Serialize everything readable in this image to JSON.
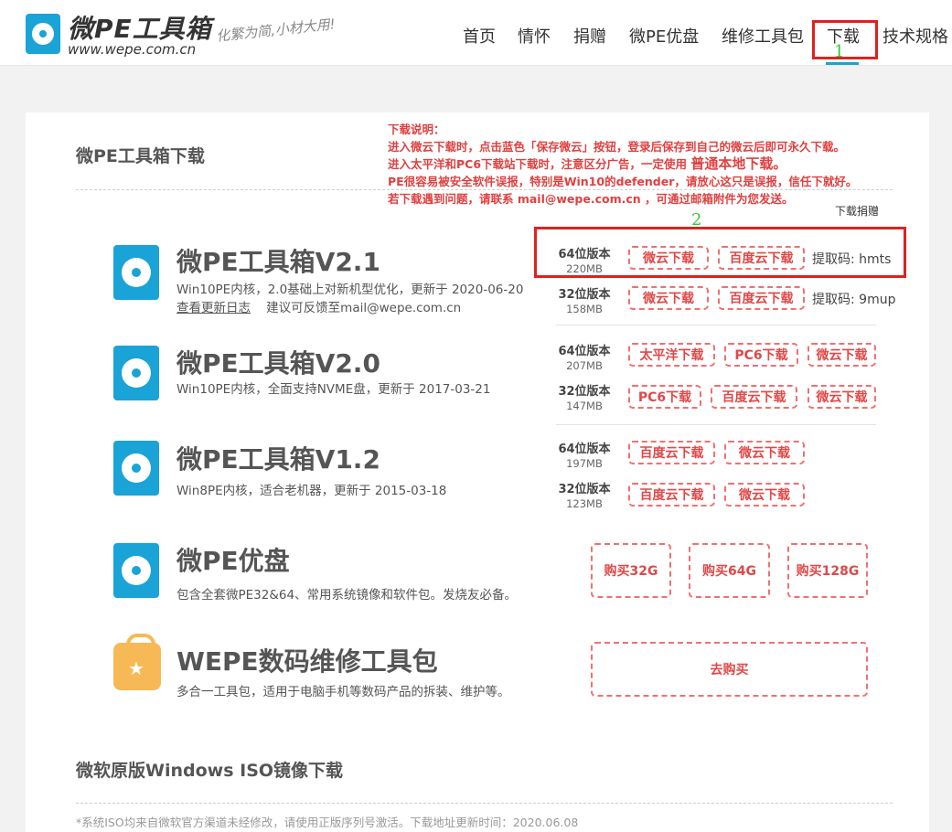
{
  "header": {
    "logo_title": "微PE工具箱",
    "logo_url": "www.wepe.com.cn",
    "slogan": "化繁为简,小材大用!",
    "nav": [
      "首页",
      "情怀",
      "捐赠",
      "微PE优盘",
      "维修工具包",
      "下载",
      "技术规格"
    ],
    "active_nav": "下载"
  },
  "annotations": {
    "box1_label": "1",
    "box2_label": "2"
  },
  "section1": {
    "title": "微PE工具箱下载",
    "notice": {
      "heading": "下载说明：",
      "line1": "进入微云下载时，点击蓝色「保存微云」按钮，登录后保存到自己的微云后即可永久下载。",
      "line2a": "进入太平洋和PC6下载站下载时，注意区分广告，一定使用",
      "line2b": "普通本地下载。",
      "line3": "PE很容易被安全软件误报，特别是Win10的defender，请放心这只是误报，信任下就好。",
      "line4": "若下载遇到问题，请联系 mail@wepe.com.cn ，可通过邮箱附件为您发送。"
    },
    "donate_link": "下载捐赠"
  },
  "products": {
    "v21": {
      "title": "微PE工具箱V2.1",
      "desc": "Win10PE内核，2.0基础上对新机型优化，更新于 2020-06-20",
      "changelog": "查看更新日志",
      "feedback": "建议可反馈至mail@wepe.com.cn",
      "r64": {
        "ver": "64位版本",
        "size": "220MB",
        "b1": "微云下载",
        "b2": "百度云下载",
        "code": "提取码: hmts"
      },
      "r32": {
        "ver": "32位版本",
        "size": "158MB",
        "b1": "微云下载",
        "b2": "百度云下载",
        "code": "提取码: 9mup"
      }
    },
    "v20": {
      "title": "微PE工具箱V2.0",
      "desc": "Win10PE内核，全面支持NVME盘，更新于 2017-03-21",
      "r64": {
        "ver": "64位版本",
        "size": "207MB",
        "b1": "太平洋下载",
        "b2": "PC6下载",
        "b3": "微云下载"
      },
      "r32": {
        "ver": "32位版本",
        "size": "147MB",
        "b1": "PC6下载",
        "b2": "百度云下载",
        "b3": "微云下载"
      }
    },
    "v12": {
      "title": "微PE工具箱V1.2",
      "desc": "Win8PE内核，适合老机器，更新于 2015-03-18",
      "r64": {
        "ver": "64位版本",
        "size": "197MB",
        "b1": "百度云下载",
        "b2": "微云下载"
      },
      "r32": {
        "ver": "32位版本",
        "size": "123MB",
        "b1": "百度云下载",
        "b2": "微云下载"
      }
    },
    "udisk": {
      "title": "微PE优盘",
      "desc": "包含全套微PE32&64、常用系统镜像和软件包。发烧友必备。",
      "b1": "购买32G",
      "b2": "购买64G",
      "b3": "购买128G"
    },
    "toolkit": {
      "title": "WEPE数码维修工具包",
      "desc": "多合一工具包，适用于电脑手机等数码产品的拆装、维护等。",
      "buy": "去购买"
    }
  },
  "section2": {
    "title": "微软原版Windows ISO镜像下载",
    "footnote": "*系统ISO均来自微软官方渠道未经修改，请使用正版序列号激活。下载地址更新时间：2020.06.08"
  },
  "colors": {
    "accent": "#1aa3d6",
    "button_red": "#e04848",
    "annotation_red": "#e02020",
    "annotation_green": "#35c935"
  }
}
